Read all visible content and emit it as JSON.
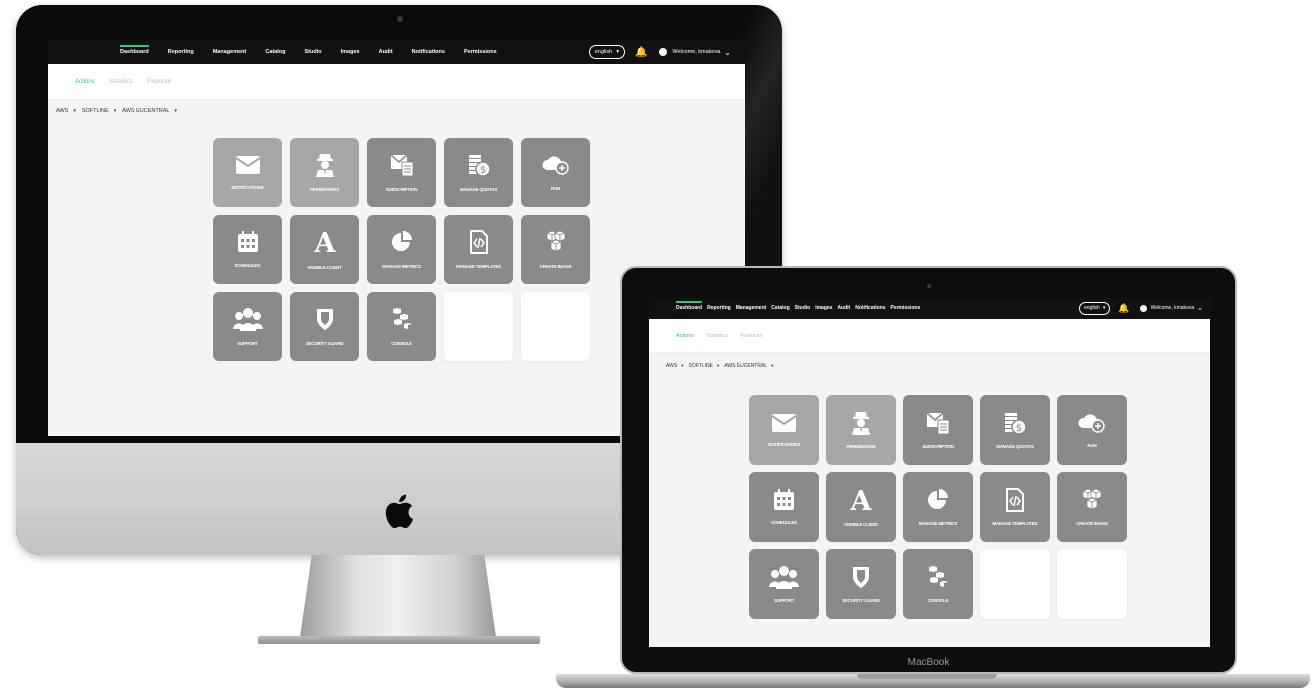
{
  "app": {
    "nav": [
      "Dashboard",
      "Reporting",
      "Management",
      "Catalog",
      "Studio",
      "Images",
      "Audit",
      "Notifications",
      "Permissions"
    ],
    "active_nav": "Dashboard",
    "language": "english",
    "language_caret": "▾",
    "bell_glyph": "🔔",
    "welcome": "Welcome, kmakova",
    "chevron": "⌄",
    "subtabs": [
      "Actions",
      "Statistics",
      "Financial"
    ],
    "active_subtab": "Actions",
    "filters": [
      "AWS",
      "SOFTLINE",
      "AWS EUCENTRAL"
    ],
    "filter_caret": "▾",
    "tiles": [
      {
        "label": "Notifications",
        "icon": "envelope-icon",
        "shade": "light"
      },
      {
        "label": "Permissions",
        "icon": "agent-icon",
        "shade": "light"
      },
      {
        "label": "Subscription",
        "icon": "subscription-form-icon",
        "shade": "dark"
      },
      {
        "label": "Manage Quotas",
        "icon": "coins-stack-icon",
        "shade": "dark"
      },
      {
        "label": "Run",
        "icon": "cloud-plus-icon",
        "shade": "dark"
      },
      {
        "label": "Schedules",
        "icon": "calendar-icon",
        "shade": "dark"
      },
      {
        "label": "Ansible Client",
        "icon": "ansible-letter-icon",
        "shade": "dark"
      },
      {
        "label": "Manage Metrics",
        "icon": "pie-chart-icon",
        "shade": "dark"
      },
      {
        "label": "Manage Templates",
        "icon": "code-file-icon",
        "shade": "dark"
      },
      {
        "label": "Create Image",
        "icon": "cubes-icon",
        "shade": "dark"
      },
      {
        "label": "Support",
        "icon": "users-group-icon",
        "shade": "dark"
      },
      {
        "label": "Security Guard",
        "icon": "shield-icon",
        "shade": "dark"
      },
      {
        "label": "Console",
        "icon": "blocks-icon",
        "shade": "dark"
      },
      {
        "label": "",
        "icon": "",
        "shade": "blank"
      },
      {
        "label": "",
        "icon": "",
        "shade": "blank"
      }
    ]
  },
  "device": {
    "laptop_label": "MacBook"
  },
  "colors": {
    "accent": "#2ecc71",
    "topbar": "#111111",
    "tile": "#8a8a8a",
    "tile_light": "#a7a7a7"
  }
}
